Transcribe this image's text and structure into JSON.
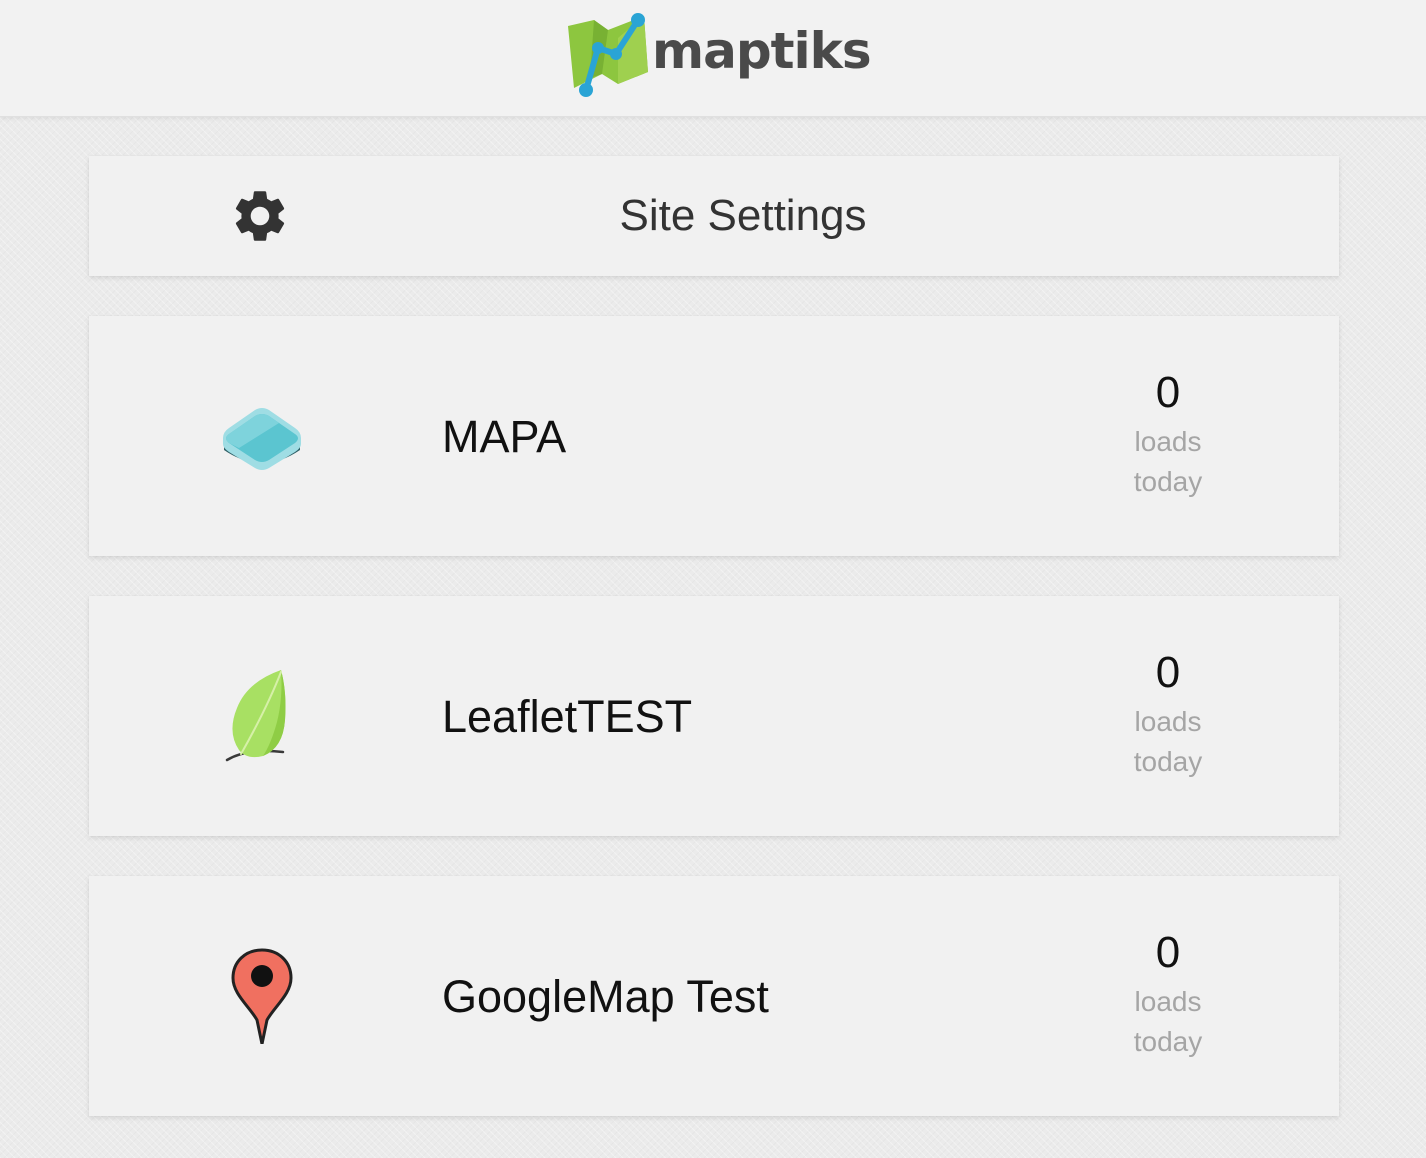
{
  "header": {
    "brand": "maptiks"
  },
  "settings": {
    "title": "Site Settings",
    "icon": "gear-icon"
  },
  "sites": [
    {
      "name": "MAPA",
      "icon": "layers-icon",
      "count": "0",
      "count_label": "loads today"
    },
    {
      "name": "LeafletTEST",
      "icon": "leaf-icon",
      "count": "0",
      "count_label": "loads today"
    },
    {
      "name": "GoogleMap Test",
      "icon": "map-pin-icon",
      "count": "0",
      "count_label": "loads today"
    }
  ],
  "colors": {
    "logo_green": "#8dc63f",
    "logo_blue": "#2aa4d5",
    "layers_teal": "#5bc5d0",
    "leaf_green": "#a8e063",
    "pin_red": "#f07060",
    "muted_text": "#a5a5a5"
  }
}
